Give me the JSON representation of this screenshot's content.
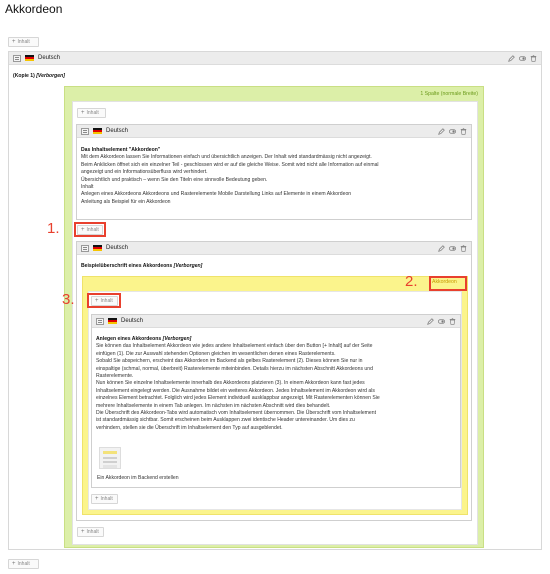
{
  "page": {
    "title": "Akkordeon",
    "add_content_label": "Inhalt"
  },
  "top_element": {
    "language": "Deutsch",
    "copy_label": "(Kopie 1)",
    "hidden_label": "[Verborgen]"
  },
  "grid_container": {
    "column_label": "1 Spalte (normale Breite)"
  },
  "element_info": {
    "language": "Deutsch",
    "heading": "Das Inhaltselement \"Akkordeon\"",
    "lines": [
      "Mit dem Akkordeon lassen Sie Informationen einfach und übersichtlich anzeigen. Der Inhalt wird standardmässig nicht angezeigt.",
      "Beim Anklicken öffnet sich ein einzelner Teil - geschlossen wird er auf die gleiche Weise. Somit wird nicht alle Information auf einmal",
      "angezeigt und ein Informationsüberfluss wird verhindert.",
      "Übersichtlich und praktisch – wenn Sie den Titeln eine sinnvolle Bedeutung geben.",
      "Inhalt",
      "Anlegen eines Akkordeons Akkordeons und Rasterelemente Mobile Darstellung Links auf Elemente in einem Akkordeon",
      "Anleitung als Beispiel für ein Akkordeon"
    ]
  },
  "element_accordion": {
    "language": "Deutsch",
    "heading": "Beispielüberschrift eines Akkordeons",
    "hidden_label": "[Verborgen]",
    "badge": "Akkordeon"
  },
  "inner_element": {
    "language": "Deutsch",
    "heading": "Anlegen eines Akkordeons",
    "hidden_label": "[Verborgen]",
    "lines": [
      "Sie können das Inhaltselement Akkordeon wie jedes andere Inhaltselement einfach über den Button [+ Inhalt] auf der Seite",
      "einfügen (1). Die zur Auswahl stehenden Optionen gleichen im wesentlichen denen eines Rasterelements.",
      "Sobald Sie abspeichern, erscheint das Akkordeon im Backend als gelbes Rasterelement (2). Dieses können Sie nur in",
      "einspaltige (schmal, normal, überbreit) Rasterelemente miteinbinden. Details hierzu im nächsten Abschnitt Akkordeons und",
      "Rasterelemente.",
      "Nun können Sie einzelne Inhaltselemente innerhalb des Akkordeons platzieren (3). In einem Akkordeon kann fast jedes",
      "Inhaltselement eingelegt werden. Die Ausnahme bildet ein weiteres Akkordeon. Jedes Inhaltselement im Akkordeon wird als",
      "einzelnes Element betrachtet. Folglich wird jedes Element individuell ausklappbar angezeigt. Mit Rasterelementen können Sie",
      "mehrere Inhaltselemente in einem Tab anlegen. Im nächsten im nächsten Abschnitt wird dies behandelt.",
      "Die Überschrift des Akkordeon-Tabs wird automatisch vom Inhaltselement übernommen. Die Überschrift vom Inhaltselement",
      "ist standardmässig sichtbar. Somit erscheinen beim Ausklappen zwei identische Header untereinander. Um dies zu",
      "verhindern, stellen sie die Überschrift im Inhaltselement den Typ  auf  ausgeblendet."
    ],
    "image_caption": "Ein Akkordeon im Backend erstellen"
  },
  "markers": {
    "one": "1.",
    "two": "2.",
    "three": "3."
  }
}
